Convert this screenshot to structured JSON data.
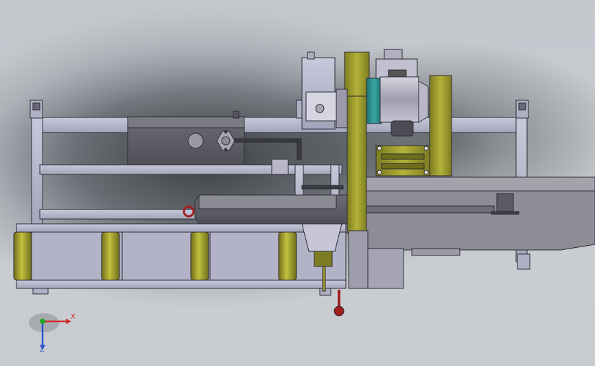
{
  "triad": {
    "x_label": "X",
    "z_label": "Z"
  },
  "colors": {
    "frame": "#b7b7cc",
    "frame_edge": "#2b2b33",
    "olive": "#9b9a2e",
    "olive_dark": "#6e6d1c",
    "teal": "#2e8b8b",
    "dark_block": "#5e5e66",
    "red": "#a01e1e",
    "x_axis": "#d12b2b",
    "y_axis": "#22aa22",
    "z_axis": "#2a55cc"
  }
}
